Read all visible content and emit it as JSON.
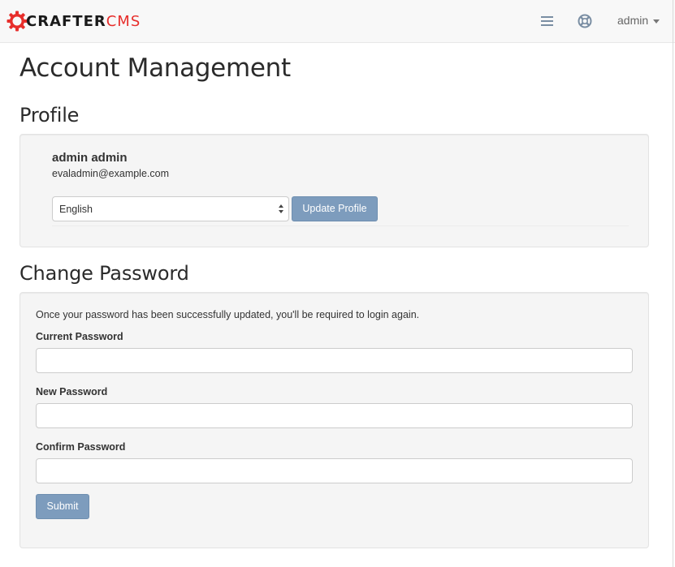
{
  "navbar": {
    "logo_crafter": "CRAFTER",
    "logo_cms": "CMS",
    "menu_icon": "hamburger-menu-icon",
    "help_icon": "life-ring-help-icon",
    "user_label": "admin",
    "brand_red": "#e72e2b"
  },
  "page": {
    "title": "Account Management"
  },
  "profile": {
    "heading": "Profile",
    "name": "admin admin",
    "email": "evaladmin@example.com",
    "language_selected": "English",
    "update_button": "Update Profile"
  },
  "change_password": {
    "heading": "Change Password",
    "note": "Once your password has been successfully updated, you'll be required to login again.",
    "current_label": "Current Password",
    "current_value": "",
    "new_label": "New Password",
    "new_value": "",
    "confirm_label": "Confirm Password",
    "confirm_value": "",
    "submit_button": "Submit"
  },
  "colors": {
    "button_primary": "#7d9cbd",
    "well_background": "#f5f5f5",
    "navbar_background": "#f8f8f8"
  }
}
